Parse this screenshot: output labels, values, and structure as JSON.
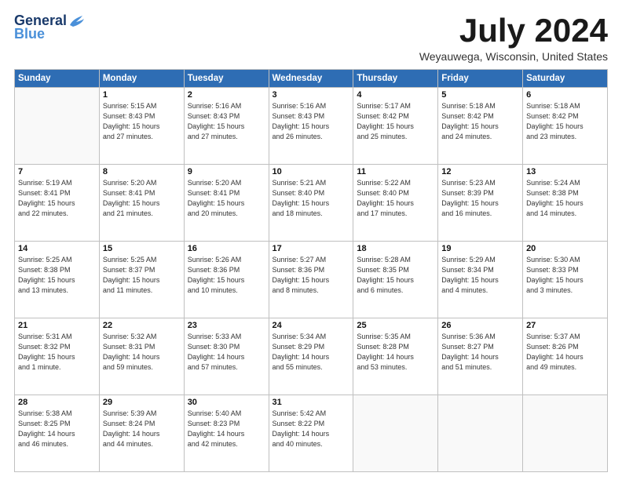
{
  "header": {
    "logo_general": "General",
    "logo_blue": "Blue",
    "title": "July 2024",
    "location": "Weyauwega, Wisconsin, United States"
  },
  "calendar": {
    "days_of_week": [
      "Sunday",
      "Monday",
      "Tuesday",
      "Wednesday",
      "Thursday",
      "Friday",
      "Saturday"
    ],
    "weeks": [
      [
        {
          "day": "",
          "info": ""
        },
        {
          "day": "1",
          "info": "Sunrise: 5:15 AM\nSunset: 8:43 PM\nDaylight: 15 hours\nand 27 minutes."
        },
        {
          "day": "2",
          "info": "Sunrise: 5:16 AM\nSunset: 8:43 PM\nDaylight: 15 hours\nand 27 minutes."
        },
        {
          "day": "3",
          "info": "Sunrise: 5:16 AM\nSunset: 8:43 PM\nDaylight: 15 hours\nand 26 minutes."
        },
        {
          "day": "4",
          "info": "Sunrise: 5:17 AM\nSunset: 8:42 PM\nDaylight: 15 hours\nand 25 minutes."
        },
        {
          "day": "5",
          "info": "Sunrise: 5:18 AM\nSunset: 8:42 PM\nDaylight: 15 hours\nand 24 minutes."
        },
        {
          "day": "6",
          "info": "Sunrise: 5:18 AM\nSunset: 8:42 PM\nDaylight: 15 hours\nand 23 minutes."
        }
      ],
      [
        {
          "day": "7",
          "info": "Sunrise: 5:19 AM\nSunset: 8:41 PM\nDaylight: 15 hours\nand 22 minutes."
        },
        {
          "day": "8",
          "info": "Sunrise: 5:20 AM\nSunset: 8:41 PM\nDaylight: 15 hours\nand 21 minutes."
        },
        {
          "day": "9",
          "info": "Sunrise: 5:20 AM\nSunset: 8:41 PM\nDaylight: 15 hours\nand 20 minutes."
        },
        {
          "day": "10",
          "info": "Sunrise: 5:21 AM\nSunset: 8:40 PM\nDaylight: 15 hours\nand 18 minutes."
        },
        {
          "day": "11",
          "info": "Sunrise: 5:22 AM\nSunset: 8:40 PM\nDaylight: 15 hours\nand 17 minutes."
        },
        {
          "day": "12",
          "info": "Sunrise: 5:23 AM\nSunset: 8:39 PM\nDaylight: 15 hours\nand 16 minutes."
        },
        {
          "day": "13",
          "info": "Sunrise: 5:24 AM\nSunset: 8:38 PM\nDaylight: 15 hours\nand 14 minutes."
        }
      ],
      [
        {
          "day": "14",
          "info": "Sunrise: 5:25 AM\nSunset: 8:38 PM\nDaylight: 15 hours\nand 13 minutes."
        },
        {
          "day": "15",
          "info": "Sunrise: 5:25 AM\nSunset: 8:37 PM\nDaylight: 15 hours\nand 11 minutes."
        },
        {
          "day": "16",
          "info": "Sunrise: 5:26 AM\nSunset: 8:36 PM\nDaylight: 15 hours\nand 10 minutes."
        },
        {
          "day": "17",
          "info": "Sunrise: 5:27 AM\nSunset: 8:36 PM\nDaylight: 15 hours\nand 8 minutes."
        },
        {
          "day": "18",
          "info": "Sunrise: 5:28 AM\nSunset: 8:35 PM\nDaylight: 15 hours\nand 6 minutes."
        },
        {
          "day": "19",
          "info": "Sunrise: 5:29 AM\nSunset: 8:34 PM\nDaylight: 15 hours\nand 4 minutes."
        },
        {
          "day": "20",
          "info": "Sunrise: 5:30 AM\nSunset: 8:33 PM\nDaylight: 15 hours\nand 3 minutes."
        }
      ],
      [
        {
          "day": "21",
          "info": "Sunrise: 5:31 AM\nSunset: 8:32 PM\nDaylight: 15 hours\nand 1 minute."
        },
        {
          "day": "22",
          "info": "Sunrise: 5:32 AM\nSunset: 8:31 PM\nDaylight: 14 hours\nand 59 minutes."
        },
        {
          "day": "23",
          "info": "Sunrise: 5:33 AM\nSunset: 8:30 PM\nDaylight: 14 hours\nand 57 minutes."
        },
        {
          "day": "24",
          "info": "Sunrise: 5:34 AM\nSunset: 8:29 PM\nDaylight: 14 hours\nand 55 minutes."
        },
        {
          "day": "25",
          "info": "Sunrise: 5:35 AM\nSunset: 8:28 PM\nDaylight: 14 hours\nand 53 minutes."
        },
        {
          "day": "26",
          "info": "Sunrise: 5:36 AM\nSunset: 8:27 PM\nDaylight: 14 hours\nand 51 minutes."
        },
        {
          "day": "27",
          "info": "Sunrise: 5:37 AM\nSunset: 8:26 PM\nDaylight: 14 hours\nand 49 minutes."
        }
      ],
      [
        {
          "day": "28",
          "info": "Sunrise: 5:38 AM\nSunset: 8:25 PM\nDaylight: 14 hours\nand 46 minutes."
        },
        {
          "day": "29",
          "info": "Sunrise: 5:39 AM\nSunset: 8:24 PM\nDaylight: 14 hours\nand 44 minutes."
        },
        {
          "day": "30",
          "info": "Sunrise: 5:40 AM\nSunset: 8:23 PM\nDaylight: 14 hours\nand 42 minutes."
        },
        {
          "day": "31",
          "info": "Sunrise: 5:42 AM\nSunset: 8:22 PM\nDaylight: 14 hours\nand 40 minutes."
        },
        {
          "day": "",
          "info": ""
        },
        {
          "day": "",
          "info": ""
        },
        {
          "day": "",
          "info": ""
        }
      ]
    ]
  }
}
